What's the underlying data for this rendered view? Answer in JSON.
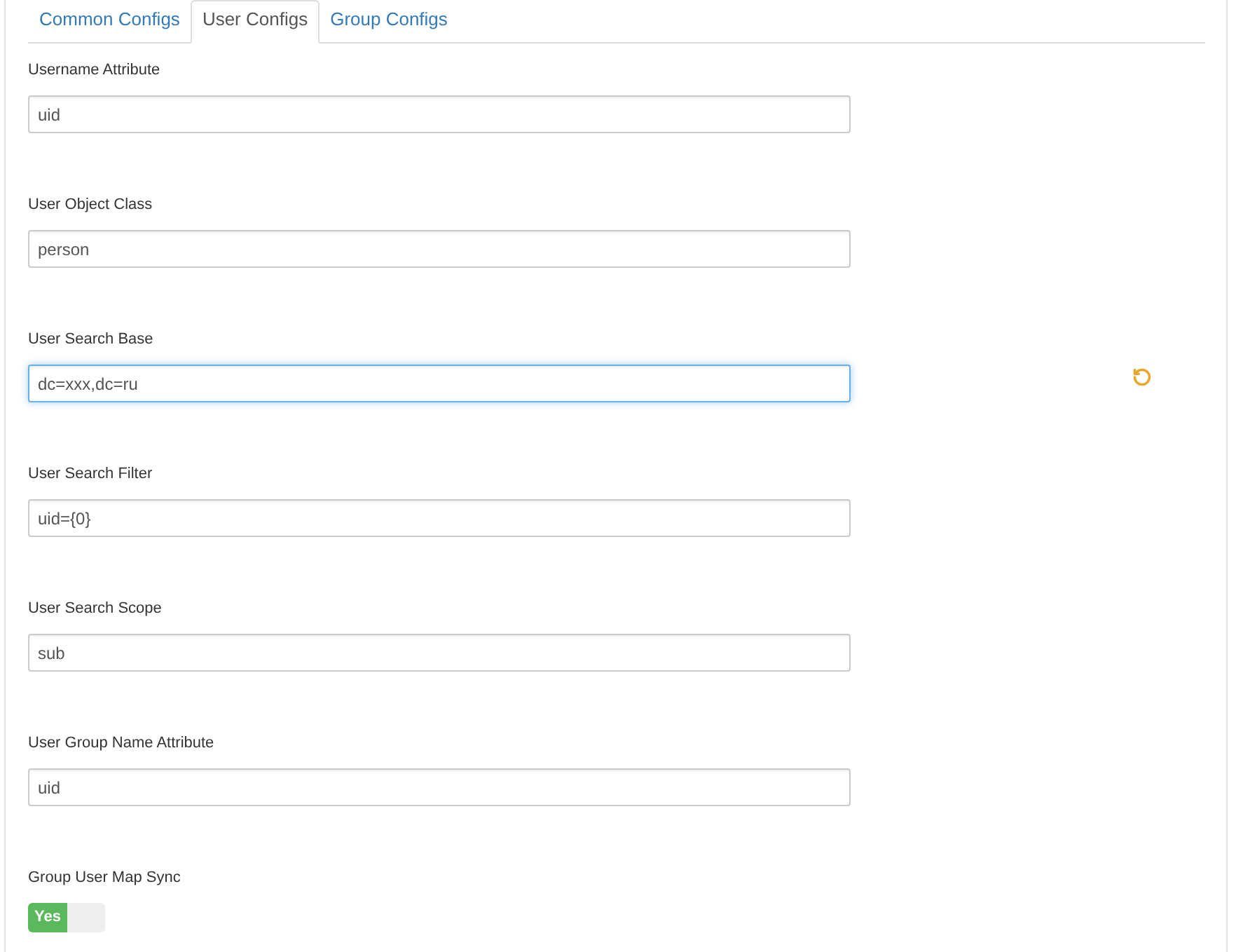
{
  "tabs": [
    {
      "label": "Common Configs",
      "selected": false
    },
    {
      "label": "User Configs",
      "selected": true
    },
    {
      "label": "Group Configs",
      "selected": false
    }
  ],
  "fields": [
    {
      "kind": "text",
      "label": "Username Attribute",
      "value": "uid",
      "focused": false,
      "changed": false
    },
    {
      "kind": "text",
      "label": "User Object Class",
      "value": "person",
      "focused": false,
      "changed": false
    },
    {
      "kind": "text",
      "label": "User Search Base",
      "value": "dc=xxx,dc=ru",
      "focused": true,
      "changed": true
    },
    {
      "kind": "text",
      "label": "User Search Filter",
      "value": "uid={0}",
      "focused": false,
      "changed": false
    },
    {
      "kind": "text",
      "label": "User Search Scope",
      "value": "sub",
      "focused": false,
      "changed": false
    },
    {
      "kind": "text",
      "label": "User Group Name Attribute",
      "value": "uid",
      "focused": false,
      "changed": false
    },
    {
      "kind": "toggle",
      "label": "Group User Map Sync",
      "on": true,
      "on_label": "Yes"
    }
  ]
}
